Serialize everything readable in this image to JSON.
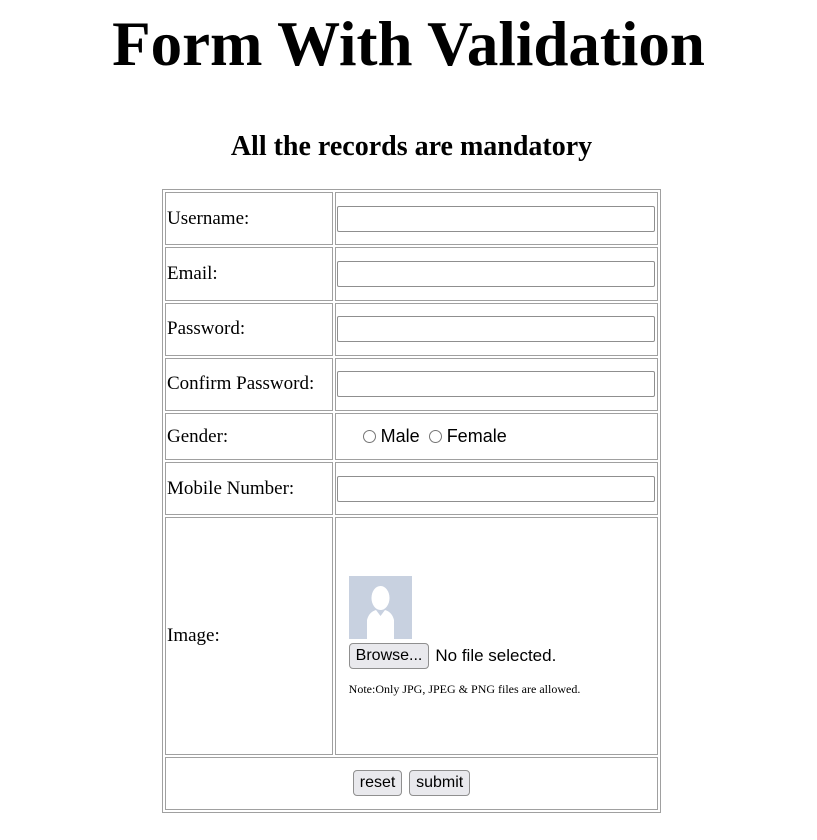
{
  "page": {
    "title": "Form With Validation",
    "subtitle": "All the records are mandatory"
  },
  "form": {
    "username_label": "Username:",
    "email_label": "Email:",
    "password_label": "Password:",
    "confirm_password_label": "Confirm Password:",
    "gender_label": "Gender:",
    "gender_options": [
      "Male",
      "Female"
    ],
    "mobile_label": "Mobile Number:",
    "image_label": "Image:",
    "browse_label": "Browse...",
    "file_status": "No file selected.",
    "note": "Note:Only JPG, JPEG & PNG files are allowed.",
    "reset_label": "reset",
    "submit_label": "submit",
    "values": {
      "username": "",
      "email": "",
      "password": "",
      "confirm_password": "",
      "mobile": ""
    },
    "icons": {
      "avatar": "avatar-placeholder-icon"
    },
    "colors": {
      "avatar_bg": "#c8d1e0",
      "avatar_fg": "#ffffff"
    }
  }
}
